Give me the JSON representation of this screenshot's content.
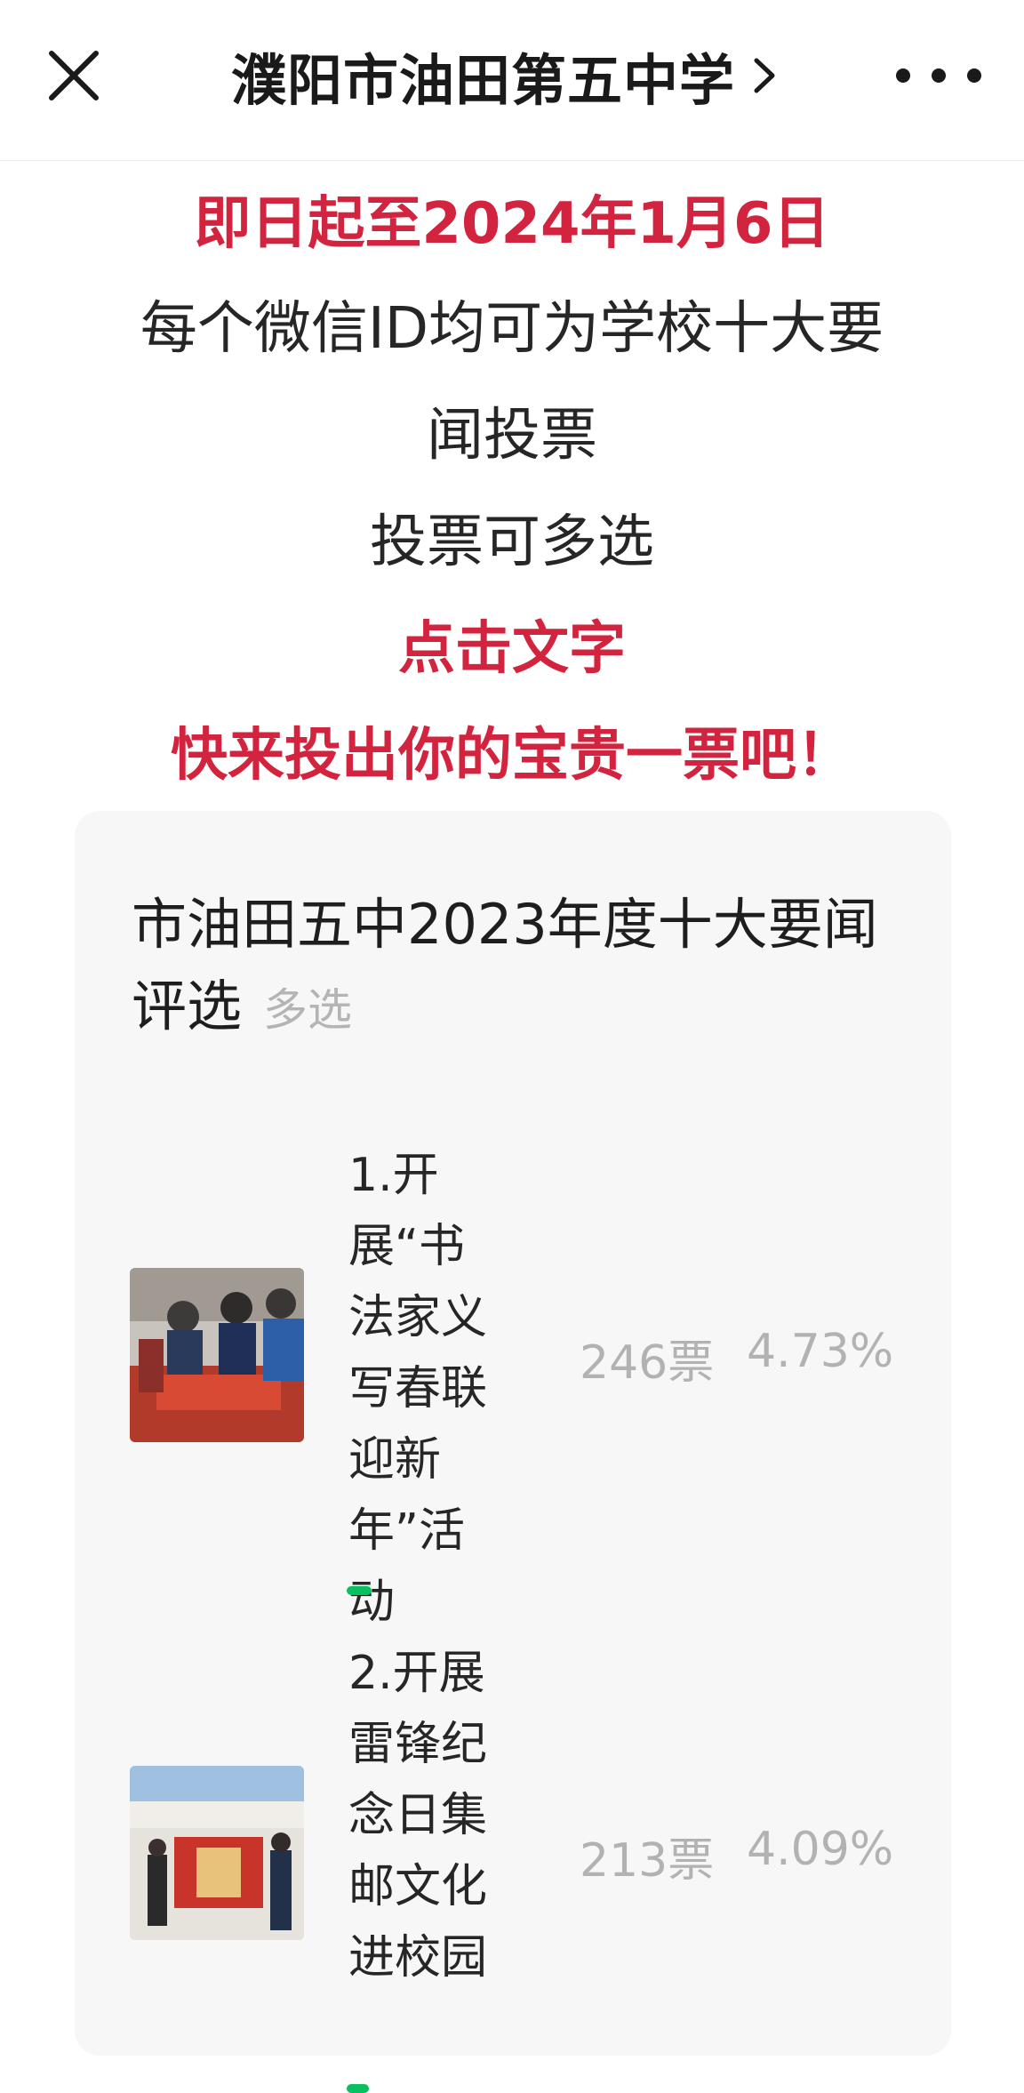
{
  "nav": {
    "title": "濮阳市油田第五中学",
    "close_icon": "close-icon",
    "chevron_icon": "chevron-right-icon",
    "more_icon": "more-icon"
  },
  "announcement": {
    "line1": "即日起至2024年1月6日",
    "line2": "每个微信ID均可为学校十大要",
    "line3": "闻投票",
    "line4": "投票可多选",
    "line5": "点击文字",
    "line6": "快来投出你的宝贵一票吧！",
    "accent_color": "#d2233f"
  },
  "vote": {
    "title": "市油田五中2023年度十大要闻评选",
    "mode": "多选",
    "options": [
      {
        "label": "1.开展“书法家义写春联迎新年”活动",
        "votes": "246票",
        "percent": "4.73%",
        "fraction": 0.0473,
        "thumb": "calligraphy-photo"
      },
      {
        "label": "2.开展雷锋纪念日集邮文化进校园",
        "votes": "213票",
        "percent": "4.09%",
        "fraction": 0.0409,
        "thumb": "stamp-exhibit-photo"
      }
    ],
    "bar_color": "#07c160"
  }
}
